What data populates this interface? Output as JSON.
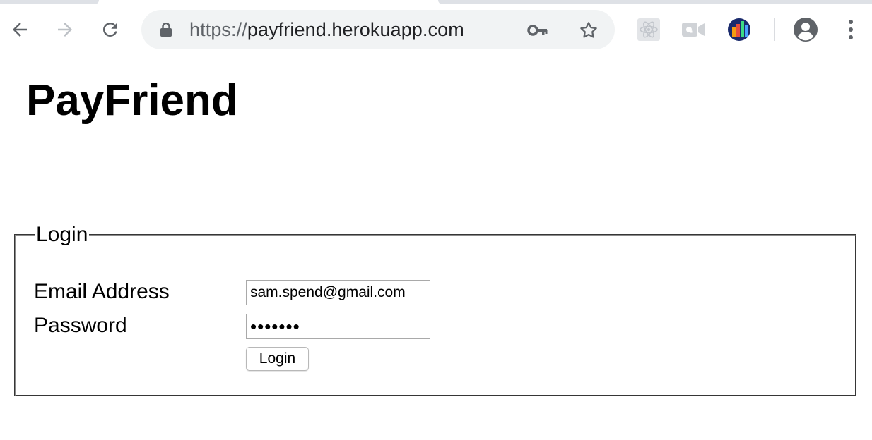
{
  "browser": {
    "url_scheme": "https://",
    "url_host": "payfriend.herokuapp.com",
    "icons": [
      "back-icon",
      "forward-icon",
      "reload-icon",
      "lock-icon",
      "key-icon",
      "bookmark-star-icon",
      "react-devtools-icon",
      "quicktime-icon",
      "extension-chart-icon",
      "profile-icon",
      "menu-dots-icon"
    ]
  },
  "page": {
    "title": "PayFriend"
  },
  "login": {
    "legend": "Login",
    "email_label": "Email Address",
    "email_value": "sam.spend@gmail.com",
    "password_label": "Password",
    "password_masked": "•••••••",
    "submit_label": "Login"
  }
}
